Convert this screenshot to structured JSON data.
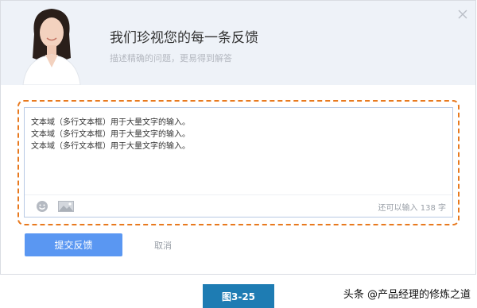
{
  "header": {
    "title": "我们珍视您的每一条反馈",
    "subtitle": "描述精确的问题，更易得到解答"
  },
  "editor": {
    "lines": [
      "文本域（多行文本框）用于大量文字的输入。",
      "文本域（多行文本框）用于大量文字的输入。",
      "文本域（多行文本框）用于大量文字的输入。"
    ],
    "counter": "还可以输入 138 字"
  },
  "actions": {
    "submit_label": "提交反馈",
    "cancel_label": "取消"
  },
  "icons": {
    "close": "close-icon",
    "emoji": "emoji-icon",
    "image": "image-icon"
  },
  "figure_label": "图3-25",
  "watermark": "头条 @产品经理的修炼之道",
  "colors": {
    "header_bg": "#eef2f8",
    "primary": "#5a97f2",
    "focus_ring": "#e8791e",
    "figure_tag": "#1e7cb3"
  }
}
